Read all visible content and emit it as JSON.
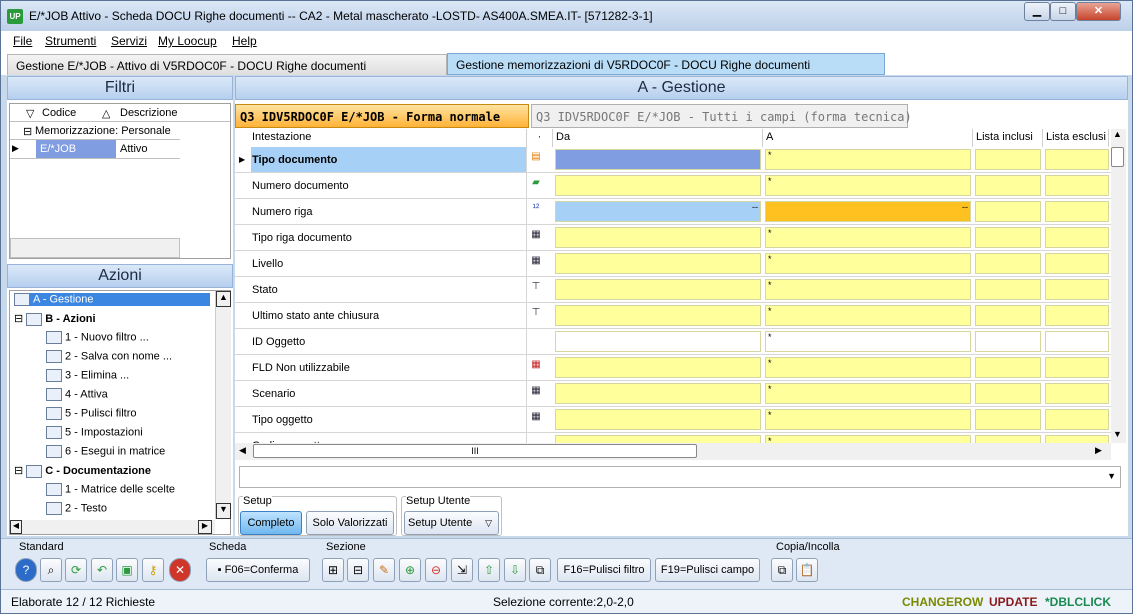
{
  "window": {
    "title": "E/*JOB Attivo - Scheda DOCU Righe documenti -- CA2 - Metal mascherato -LOSTD- AS400A.SMEA.IT- [571282-3-1]",
    "app_icon": "UP",
    "min": "▁",
    "max": "□",
    "close": "✕"
  },
  "menu": [
    "File",
    "Strumenti",
    "Servizi",
    "My Loocup",
    "Help"
  ],
  "page_tabs": [
    "Gestione E/*JOB - Attivo di V5RDOC0F - DOCU Righe documenti",
    "Gestione memorizzazioni di V5RDOC0F - DOCU Righe documenti"
  ],
  "filtri": {
    "title": "Filtri",
    "col1": "Codice",
    "col2": "Descrizione",
    "group": "Memorizzazione: Personale",
    "code": "E/*JOB",
    "desc": "Attivo"
  },
  "azioni": {
    "title": "Azioni",
    "items": [
      {
        "label": "A - Gestione",
        "bold": false,
        "level": 0
      },
      {
        "label": "B - Azioni",
        "bold": true,
        "level": 0
      },
      {
        "label": "1 - Nuovo filtro ...",
        "level": 1
      },
      {
        "label": "2 - Salva con nome ...",
        "level": 1
      },
      {
        "label": "3 - Elimina ...",
        "level": 1
      },
      {
        "label": "4 - Attiva",
        "level": 1
      },
      {
        "label": "5 - Pulisci filtro",
        "level": 1
      },
      {
        "label": "5 - Impostazioni",
        "level": 1
      },
      {
        "label": "6 - Esegui in matrice",
        "level": 1
      },
      {
        "label": "C - Documentazione",
        "bold": true,
        "level": 0
      },
      {
        "label": "1 - Matrice delle scelte",
        "level": 1
      },
      {
        "label": "2 - Testo",
        "level": 1
      }
    ]
  },
  "main": {
    "title": "A - Gestione",
    "tabs": [
      "Q3 IDV5RDOC0F E/*JOB - Forma normale",
      "Q3 IDV5RDOC0F E/*JOB - Tutti i campi (forma tecnica)"
    ],
    "columns": [
      "Intestazione",
      "·",
      "Da",
      "A",
      "Lista inclusi",
      "Lista esclusi"
    ],
    "rows": [
      {
        "label": "Tipo documento",
        "icon": "doc-icon",
        "a": "*"
      },
      {
        "label": "Numero documento",
        "icon": "doc-green-icon",
        "a": "*"
      },
      {
        "label": "Numero riga",
        "icon": "number-icon",
        "da": "--",
        "a": "--"
      },
      {
        "label": "Tipo riga documento",
        "icon": "table-icon",
        "a": "*"
      },
      {
        "label": "Livello",
        "icon": "table-icon",
        "a": "*"
      },
      {
        "label": "Stato",
        "icon": "tree-icon",
        "a": "*"
      },
      {
        "label": "Ultimo stato ante chiusura",
        "icon": "tree-icon",
        "a": "*"
      },
      {
        "label": "ID Oggetto",
        "icon": "",
        "a": "*"
      },
      {
        "label": "FLD Non utilizzabile",
        "icon": "table-red-icon",
        "a": "*"
      },
      {
        "label": "Scenario",
        "icon": "table-icon",
        "a": "*"
      },
      {
        "label": "Tipo oggetto",
        "icon": "table-icon",
        "a": "*"
      },
      {
        "label": "Codice oggetto",
        "icon": "",
        "a": "*"
      }
    ],
    "hscroll": "III"
  },
  "setup": {
    "label": "Setup",
    "completo": "Completo",
    "solo": "Solo Valorizzati",
    "utente_label": "Setup Utente",
    "utente_btn": "Setup Utente"
  },
  "toolbar": {
    "standard": "Standard",
    "scheda": "Scheda",
    "sezione": "Sezione",
    "copia": "Copia/Incolla",
    "f06": "F06=Conferma",
    "f16": "F16=Pulisci filtro",
    "f19": "F19=Pulisci campo"
  },
  "status": {
    "left": "Elaborate 12 / 12 Richieste",
    "mid": "Selezione corrente:2,0-2,0",
    "changerow": "CHANGEROW",
    "update": "UPDATE",
    "dblclick": "*DBLCLICK"
  },
  "colors": {
    "yellow": "#ffff9c",
    "selected": "#7f9de0",
    "orange": "#ffc11f",
    "lightblue": "#a6d0f5"
  }
}
